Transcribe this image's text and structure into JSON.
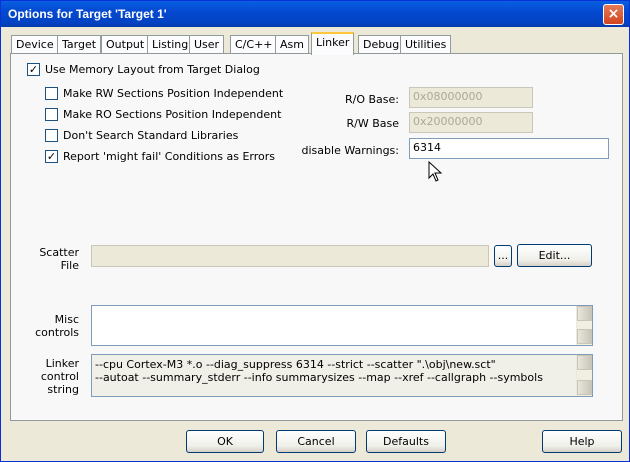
{
  "window": {
    "title": "Options for Target 'Target 1'",
    "close_glyph": "×"
  },
  "tabs": [
    "Device",
    "Target",
    "Output",
    "Listing",
    "User",
    "C/C++",
    "Asm",
    "Linker",
    "Debug",
    "Utilities"
  ],
  "active_tab": "Linker",
  "linker": {
    "use_memory_layout": {
      "label": "Use Memory Layout from Target Dialog",
      "checked": true
    },
    "rw_independent": {
      "label": "Make RW Sections Position Independent",
      "checked": false
    },
    "ro_independent": {
      "label": "Make RO Sections Position Independent",
      "checked": false
    },
    "dont_search_libs": {
      "label": "Don't Search Standard Libraries",
      "checked": false
    },
    "report_might_fail": {
      "label": "Report 'might fail' Conditions as Errors",
      "checked": true
    },
    "ro_base": {
      "label": "R/O Base:",
      "value": "0x08000000"
    },
    "rw_base": {
      "label": "R/W Base",
      "value": "0x20000000"
    },
    "disable_warnings": {
      "label": "disable Warnings:",
      "value": "6314"
    },
    "scatter": {
      "label_line1": "Scatter",
      "label_line2": "File",
      "value": "",
      "browse_label": "...",
      "edit_label": "Edit..."
    },
    "misc": {
      "label_line1": "Misc",
      "label_line2": "controls",
      "value": ""
    },
    "control_string": {
      "label_line1": "Linker",
      "label_line2": "control",
      "label_line3": "string",
      "line1": "--cpu Cortex-M3 *.o --diag_suppress 6314 --strict --scatter \".\\obj\\new.sct\"",
      "line2": "--autoat --summary_stderr --info summarysizes --map --xref --callgraph --symbols"
    }
  },
  "footer": {
    "ok": "OK",
    "cancel": "Cancel",
    "defaults": "Defaults",
    "help": "Help"
  },
  "check_glyph": "✓"
}
